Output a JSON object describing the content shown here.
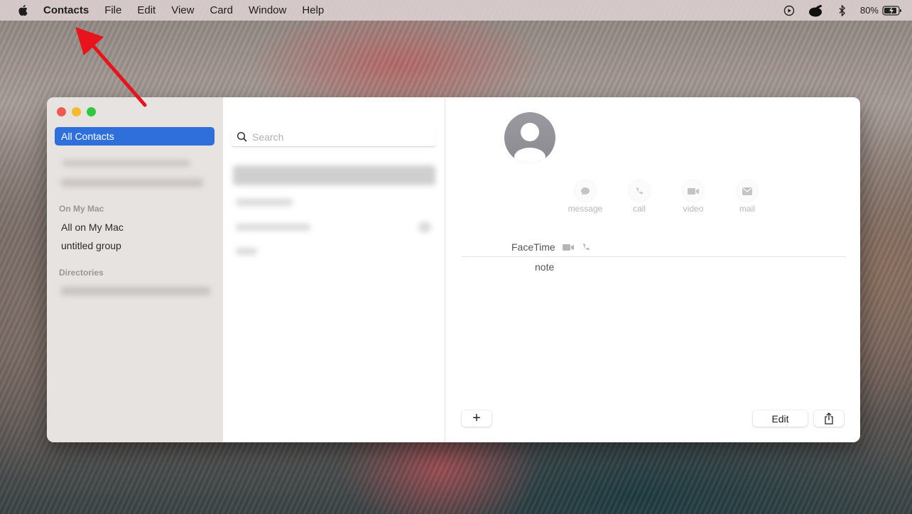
{
  "menubar": {
    "app_name": "Contacts",
    "menus": [
      "File",
      "Edit",
      "View",
      "Card",
      "Window",
      "Help"
    ],
    "battery": "80%",
    "status_icons": [
      "play-circle-icon",
      "app-extra-icon",
      "bluetooth-icon",
      "battery-charging-icon"
    ]
  },
  "sidebar": {
    "selected": "All Contacts",
    "sections": [
      {
        "title": "On My Mac",
        "items": [
          "All on My Mac",
          "untitled group"
        ]
      },
      {
        "title": "Directories",
        "items": []
      }
    ]
  },
  "list": {
    "search_placeholder": "Search"
  },
  "detail": {
    "actions": [
      {
        "label": "message",
        "icon": "message-icon"
      },
      {
        "label": "call",
        "icon": "phone-icon"
      },
      {
        "label": "video",
        "icon": "video-icon"
      },
      {
        "label": "mail",
        "icon": "mail-icon"
      }
    ],
    "facetime_label": "FaceTime",
    "note_label": "note",
    "add_label": "+",
    "edit_label": "Edit"
  },
  "colors": {
    "selection": "#2f6fdc",
    "annotation_arrow": "#e8141c"
  }
}
